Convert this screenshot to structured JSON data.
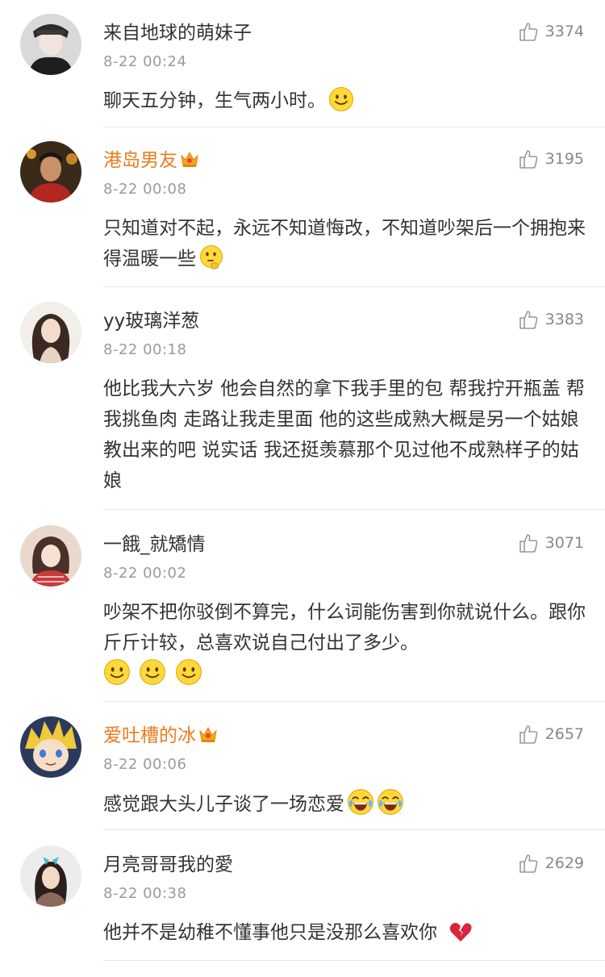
{
  "comments": [
    {
      "username": "来自地球的萌妹子",
      "vip": false,
      "time": "8-22 00:24",
      "likes": "3374",
      "text": "聊天五分钟，生气两小时。",
      "emojis": [
        "smile"
      ],
      "avatar_icon": "avatar-face-icon"
    },
    {
      "username": "港岛男友",
      "vip": true,
      "time": "8-22 00:08",
      "likes": "3195",
      "text": "只知道对不起，永远不知道悔改，不知道吵架后一个拥抱来得温暖一些",
      "emojis": [
        "thinking"
      ],
      "avatar_icon": "avatar-face-icon"
    },
    {
      "username": "yy玻璃洋葱",
      "vip": false,
      "time": "8-22 00:18",
      "likes": "3383",
      "text": "他比我大六岁 他会自然的拿下我手里的包 帮我拧开瓶盖 帮我挑鱼肉 走路让我走里面 他的这些成熟大概是另一个姑娘教出来的吧 说实话 我还挺羡慕那个见过他不成熟样子的姑娘",
      "emojis": [],
      "avatar_icon": "avatar-face-icon"
    },
    {
      "username": "一餓_就矯情",
      "vip": false,
      "time": "8-22 00:02",
      "likes": "3071",
      "text": "吵架不把你驳倒不算完，什么词能伤害到你就说什么。跟你斤斤计较，总喜欢说自己付出了多少。",
      "emojis": [
        "smile",
        "smile",
        "smile"
      ],
      "avatar_icon": "avatar-face-icon"
    },
    {
      "username": "爱吐槽的冰",
      "vip": true,
      "time": "8-22 00:06",
      "likes": "2657",
      "text": "感觉跟大头儿子谈了一场恋爱",
      "emojis": [
        "laugh",
        "laugh"
      ],
      "avatar_icon": "avatar-anime-icon"
    },
    {
      "username": "月亮哥哥我的愛",
      "vip": false,
      "time": "8-22 00:38",
      "likes": "2629",
      "text": "他并不是幼稚不懂事他只是没那么喜欢你",
      "emojis": [
        "broken-heart"
      ],
      "avatar_icon": "avatar-face-icon"
    }
  ],
  "colors": {
    "vip_name": "#ee7b1e",
    "text": "#333333",
    "meta": "#9a9a9a",
    "divider": "#e6e6e6"
  }
}
